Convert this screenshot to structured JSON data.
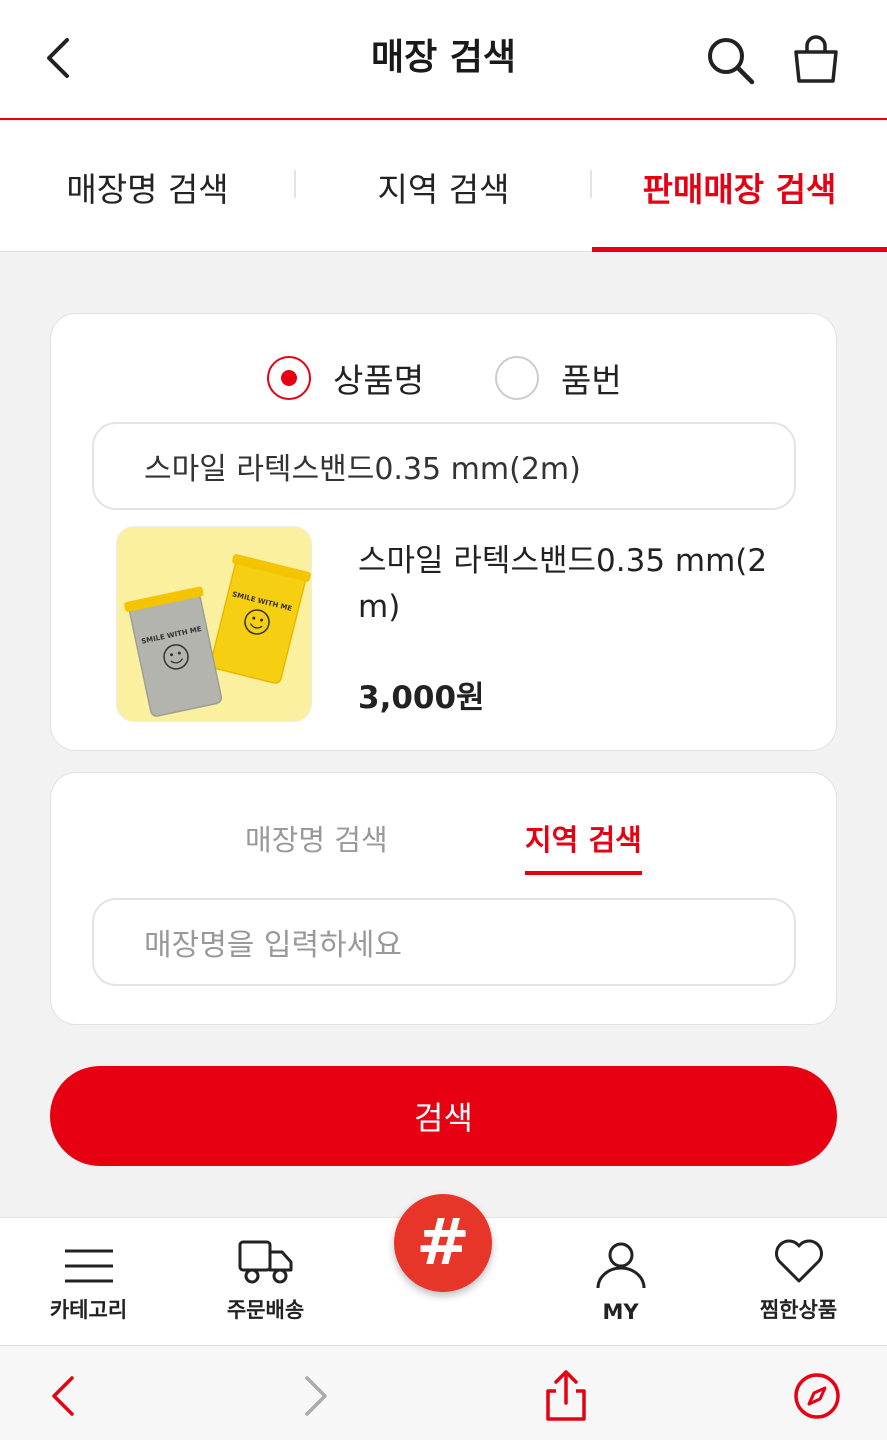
{
  "header": {
    "title": "매장 검색",
    "icons": [
      "back-arrow-icon",
      "search-icon",
      "shopping-bag-icon"
    ]
  },
  "tabs": [
    {
      "label": "매장명 검색",
      "active": false
    },
    {
      "label": "지역 검색",
      "active": false
    },
    {
      "label": "판매매장 검색",
      "active": true
    }
  ],
  "product_search": {
    "radio_options": [
      {
        "label": "상품명",
        "selected": true
      },
      {
        "label": "품번",
        "selected": false
      }
    ],
    "input_value": "스마일 라텍스밴드0.35 mm(2m)",
    "product": {
      "name": "스마일 라텍스밴드0.35 mm(2m)",
      "price": "3,000원",
      "image_text": "SMILE WITH ME"
    }
  },
  "store_search": {
    "subtabs": [
      {
        "label": "매장명 검색",
        "active": false
      },
      {
        "label": "지역 검색",
        "active": true
      }
    ],
    "input_placeholder": "매장명을 입력하세요"
  },
  "search_button": "검색",
  "bottom_nav": [
    {
      "label": "카테고리",
      "icon": "menu-icon"
    },
    {
      "label": "주문배송",
      "icon": "truck-icon"
    },
    {
      "label": "#",
      "icon": "hashtag-icon"
    },
    {
      "label": "MY",
      "icon": "person-icon"
    },
    {
      "label": "찜한상품",
      "icon": "heart-icon"
    }
  ],
  "browser_bar": {
    "icons": [
      "browser-back-icon",
      "browser-forward-icon",
      "share-icon",
      "compass-icon"
    ]
  },
  "colors": {
    "accent": "#e60012",
    "background": "#f2f2f2"
  }
}
